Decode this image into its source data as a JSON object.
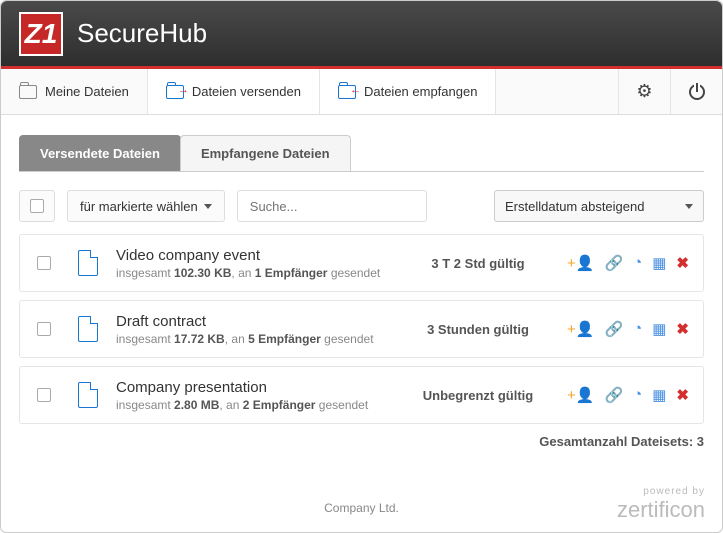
{
  "header": {
    "logoLetter": "Z1",
    "title": "SecureHub"
  },
  "nav": {
    "myFiles": "Meine Dateien",
    "sendFiles": "Dateien versenden",
    "receiveFiles": "Dateien empfangen"
  },
  "tabs": {
    "sent": "Versendete Dateien",
    "received": "Empfangene Dateien"
  },
  "toolbar": {
    "bulkAction": "für markierte wählen",
    "searchPlaceholder": "Suche...",
    "sortSelected": "Erstelldatum absteigend"
  },
  "labels": {
    "totalPre": "insgesamt ",
    "sentToPre": ", an ",
    "recipientSingular": "Empfänger",
    "sentSuffix": " gesendet",
    "totalCountLabel": "Gesamtanzahl Dateisets: ",
    "poweredBy": "powered by",
    "brand": "zertificon",
    "company": "Company Ltd."
  },
  "files": [
    {
      "title": "Video company event",
      "size": "102.30 KB",
      "recipients": "1",
      "validity": "3 T 2 Std gültig"
    },
    {
      "title": "Draft contract",
      "size": "17.72 KB",
      "recipients": "5",
      "validity": "3 Stunden gültig"
    },
    {
      "title": "Company presentation",
      "size": "2.80 MB",
      "recipients": "2",
      "validity": "Unbegrenzt gültig"
    }
  ],
  "totalCount": "3"
}
